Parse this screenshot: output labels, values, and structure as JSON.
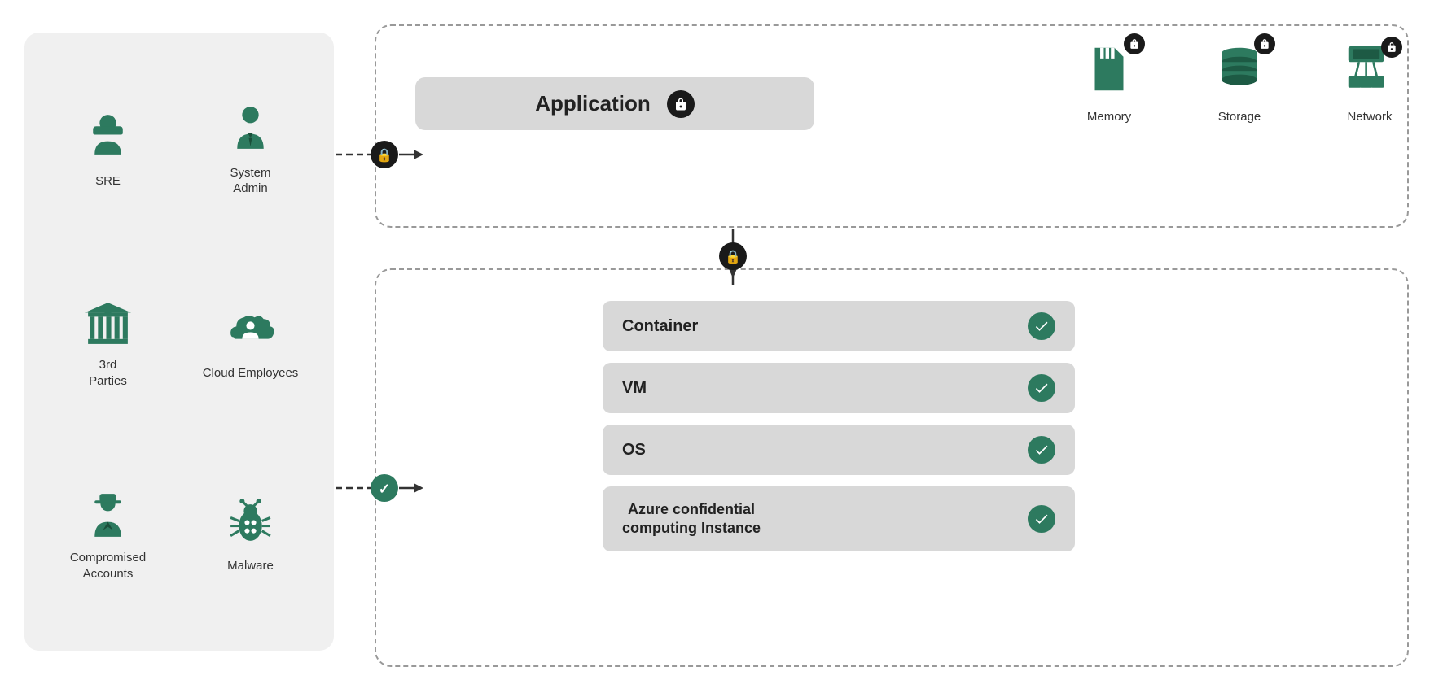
{
  "actors": [
    {
      "id": "sre",
      "label": "SRE",
      "icon": "person"
    },
    {
      "id": "system-admin",
      "label": "System\nAdmin",
      "icon": "person-admin"
    },
    {
      "id": "third-parties",
      "label": "3rd\nParties",
      "icon": "building"
    },
    {
      "id": "cloud-employees",
      "label": "Cloud\nEmployees",
      "icon": "cloud-person"
    },
    {
      "id": "compromised-accounts",
      "label": "Compromised\nAccounts",
      "icon": "spy"
    },
    {
      "id": "malware",
      "label": "Malware",
      "icon": "bug"
    }
  ],
  "app": {
    "label": "Application"
  },
  "resources": [
    {
      "id": "memory",
      "label": "Memory"
    },
    {
      "id": "storage",
      "label": "Storage"
    },
    {
      "id": "network",
      "label": "Network"
    }
  ],
  "infra_items": [
    {
      "id": "container",
      "label": "Container"
    },
    {
      "id": "vm",
      "label": "VM"
    },
    {
      "id": "os",
      "label": "OS"
    },
    {
      "id": "azure",
      "label": "Azure confidential\ncomputing Instance"
    }
  ],
  "colors": {
    "green": "#2d7a5f",
    "dark": "#1a1a1a",
    "bg_panel": "#f0f0f0",
    "bg_bar": "#d8d8d8"
  }
}
